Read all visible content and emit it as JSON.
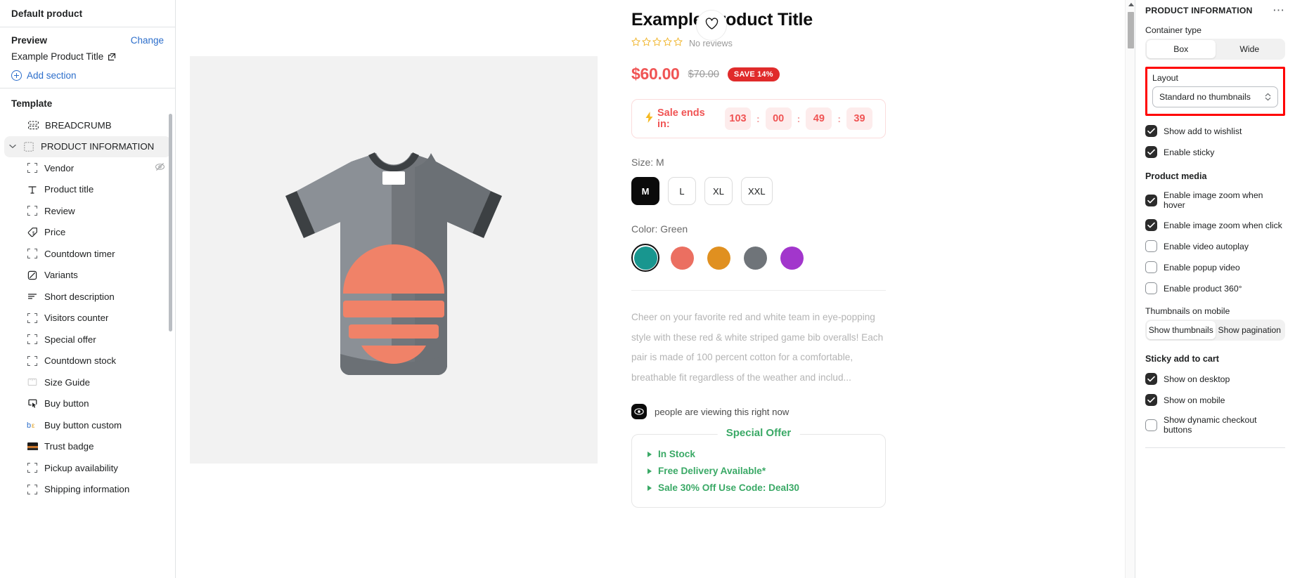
{
  "sidebar": {
    "title": "Default product",
    "preview_label": "Preview",
    "change_label": "Change",
    "preview_value": "Example Product Title",
    "add_section_label": "Add section",
    "template_label": "Template",
    "sections": [
      {
        "label": "BREADCRUMB",
        "icon": "breadcrumb-icon",
        "level": 0,
        "active": false
      },
      {
        "label": "PRODUCT INFORMATION",
        "icon": "section-icon",
        "level": 0,
        "active": true
      }
    ],
    "blocks": [
      {
        "label": "Vendor",
        "icon": "placeholder-icon",
        "hidden": true
      },
      {
        "label": "Product title",
        "icon": "text-icon",
        "hidden": false
      },
      {
        "label": "Review",
        "icon": "placeholder-icon",
        "hidden": false
      },
      {
        "label": "Price",
        "icon": "price-tag-icon",
        "hidden": false
      },
      {
        "label": "Countdown timer",
        "icon": "placeholder-icon",
        "hidden": false
      },
      {
        "label": "Variants",
        "icon": "variants-icon",
        "hidden": false
      },
      {
        "label": "Short description",
        "icon": "text-lines-icon",
        "hidden": false
      },
      {
        "label": "Visitors counter",
        "icon": "placeholder-icon",
        "hidden": false
      },
      {
        "label": "Special offer",
        "icon": "placeholder-icon",
        "hidden": false
      },
      {
        "label": "Countdown stock",
        "icon": "placeholder-icon",
        "hidden": false
      },
      {
        "label": "Size Guide",
        "icon": "size-guide-icon",
        "hidden": false
      },
      {
        "label": "Buy button",
        "icon": "cursor-click-icon",
        "hidden": false
      },
      {
        "label": "Buy button custom",
        "icon": "be-icon",
        "hidden": false
      },
      {
        "label": "Trust badge",
        "icon": "trust-badge-icon",
        "hidden": false
      },
      {
        "label": "Pickup availability",
        "icon": "placeholder-icon",
        "hidden": false
      },
      {
        "label": "Shipping information",
        "icon": "placeholder-icon",
        "hidden": false
      }
    ]
  },
  "product": {
    "title": "Example Product Title",
    "reviews_text": "No reviews",
    "stars": 5,
    "price": "$60.00",
    "compare_price": "$70.00",
    "save_badge": "SAVE 14%",
    "countdown": {
      "label": "Sale ends in:",
      "days": "103",
      "hours": "00",
      "minutes": "49",
      "seconds": "39",
      "separator": ":"
    },
    "size": {
      "label": "Size:",
      "value": "M",
      "options": [
        "M",
        "L",
        "XL",
        "XXL"
      ],
      "selected": "M"
    },
    "color": {
      "label": "Color:",
      "value": "Green",
      "swatches": [
        "#18968f",
        "#eb6f61",
        "#e09020",
        "#6f7479",
        "#a236cc"
      ],
      "selected_index": 0
    },
    "description": "Cheer on your favorite red and white team in eye-popping style with these red & white striped game bib overalls! Each pair is made of 100 percent cotton for a comfortable, breathable fit regardless of the weather and includ...",
    "viewers_text": "people are viewing this right now",
    "special_offer": {
      "title": "Special Offer",
      "items": [
        "In Stock",
        "Free Delivery Available*",
        "Sale 30% Off Use Code: Deal30"
      ]
    }
  },
  "right_panel": {
    "title": "PRODUCT INFORMATION",
    "container_type": {
      "label": "Container type",
      "options": [
        "Box",
        "Wide"
      ],
      "selected": "Box"
    },
    "layout": {
      "label": "Layout",
      "value": "Standard no thumbnails"
    },
    "checkboxes_top": [
      {
        "label": "Show add to wishlist",
        "checked": true
      },
      {
        "label": "Enable sticky",
        "checked": true
      }
    ],
    "product_media": {
      "title": "Product media",
      "checkboxes": [
        {
          "label": "Enable image zoom when hover",
          "checked": true
        },
        {
          "label": "Enable image zoom when click",
          "checked": true
        },
        {
          "label": "Enable video autoplay",
          "checked": false
        },
        {
          "label": "Enable popup video",
          "checked": false
        },
        {
          "label": "Enable product 360°",
          "checked": false
        }
      ],
      "thumbnails_label": "Thumbnails on mobile",
      "thumbnails_options": [
        "Show thumbnails",
        "Show pagination"
      ],
      "thumbnails_selected": "Show thumbnails"
    },
    "sticky_add_to_cart": {
      "title": "Sticky add to cart",
      "checkboxes": [
        {
          "label": "Show on desktop",
          "checked": true
        },
        {
          "label": "Show on mobile",
          "checked": true
        },
        {
          "label": "Show dynamic checkout buttons",
          "checked": false
        }
      ]
    },
    "highlight_color": "#ff0000"
  }
}
